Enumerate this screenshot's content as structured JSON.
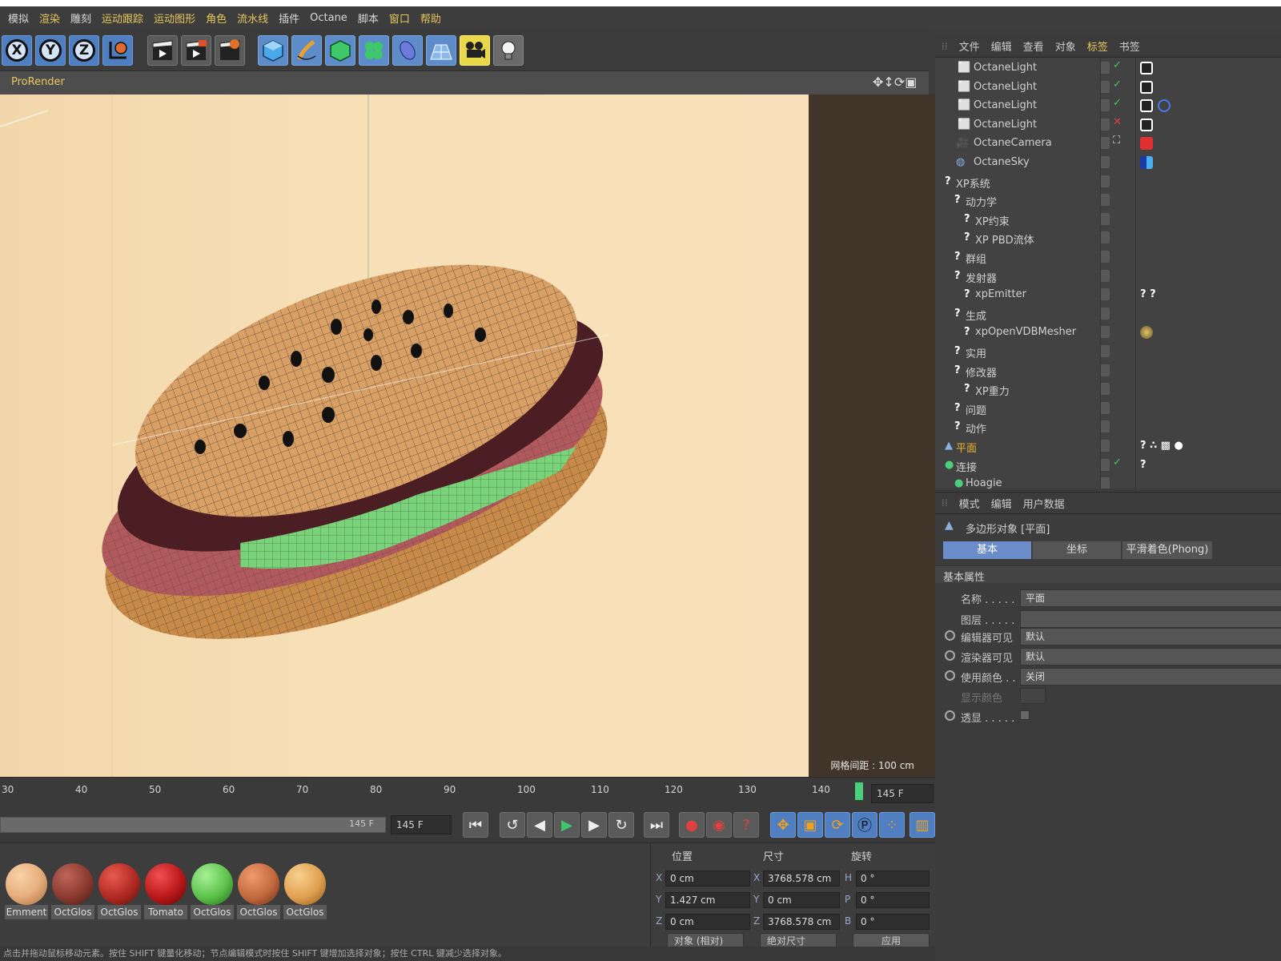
{
  "menu": {
    "items": [
      "模拟",
      "渲染",
      "雕刻",
      "运动跟踪",
      "运动图形",
      "角色",
      "流水线",
      "插件",
      "Octane",
      "脚本",
      "窗口",
      "帮助"
    ]
  },
  "toolbar": {
    "axis_x": "X",
    "axis_y": "Y",
    "axis_z": "Z",
    "icons": [
      "axis-x-icon",
      "axis-y-icon",
      "axis-z-icon",
      "world-coord-icon",
      "render-view-icon",
      "render-picture-queue-icon",
      "render-settings-icon",
      "cube-icon",
      "pen-icon",
      "subdivision-icon",
      "cloner-icon",
      "deformer-icon",
      "floor-icon",
      "camera-icon",
      "light-icon"
    ]
  },
  "viewport": {
    "renderer_label": "ProRender",
    "grid_label": "网格间距 : 100 cm"
  },
  "timeline": {
    "ticks": [
      "30",
      "40",
      "50",
      "60",
      "70",
      "80",
      "90",
      "100",
      "110",
      "120",
      "130",
      "140"
    ],
    "current_frame": "145 F"
  },
  "playbar": {
    "end_frame_slider": "145 F",
    "end_frame_field": "145 F"
  },
  "materials": [
    {
      "name": "Emment",
      "color": "#e8b07e"
    },
    {
      "name": "OctGlos",
      "color": "#8a3a2e"
    },
    {
      "name": "OctGlos",
      "color": "#b02a22"
    },
    {
      "name": "Tomato",
      "color": "#b81818"
    },
    {
      "name": "OctGlos",
      "color": "#5cc24a"
    },
    {
      "name": "OctGlos",
      "color": "#c26a3e"
    },
    {
      "name": "OctGlos",
      "color": "#e0a050"
    }
  ],
  "coords": {
    "headers": {
      "position": "位置",
      "size": "尺寸",
      "rotation": "旋转"
    },
    "rows": [
      {
        "axis": "X",
        "pos": "0 cm",
        "size_axis": "X",
        "size": "3768.578 cm",
        "rot_axis": "H",
        "rot": "0 °"
      },
      {
        "axis": "Y",
        "pos": "1.427 cm",
        "size_axis": "Y",
        "size": "0 cm",
        "rot_axis": "P",
        "rot": "0 °"
      },
      {
        "axis": "Z",
        "pos": "0 cm",
        "size_axis": "Z",
        "size": "3768.578 cm",
        "rot_axis": "B",
        "rot": "0 °"
      }
    ],
    "mode": "对象 (相对)",
    "size_mode": "绝对尺寸",
    "apply": "应用"
  },
  "status": {
    "text": "点击并拖动鼠标移动元素。按住 SHIFT 键量化移动；节点编辑模式时按住 SHIFT 键增加选择对象；按住 CTRL 键减少选择对象。"
  },
  "object_manager": {
    "menu": [
      "文件",
      "编辑",
      "查看",
      "对象",
      "标签",
      "书签"
    ],
    "objects": [
      {
        "name": "OctaneLight",
        "indent": 0,
        "icon": "light"
      },
      {
        "name": "OctaneLight",
        "indent": 0,
        "icon": "light"
      },
      {
        "name": "OctaneLight",
        "indent": 0,
        "icon": "light"
      },
      {
        "name": "OctaneLight",
        "indent": 0,
        "icon": "light"
      },
      {
        "name": "OctaneCamera",
        "indent": 0,
        "icon": "camera"
      },
      {
        "name": "OctaneSky",
        "indent": 0,
        "icon": "sky"
      },
      {
        "name": "XP系统",
        "indent": 0,
        "icon": "question"
      },
      {
        "name": "动力学",
        "indent": 1,
        "icon": "question"
      },
      {
        "name": "XP约束",
        "indent": 2,
        "icon": "question"
      },
      {
        "name": "XP PBD流体",
        "indent": 2,
        "icon": "question"
      },
      {
        "name": "群组",
        "indent": 1,
        "icon": "question"
      },
      {
        "name": "发射器",
        "indent": 1,
        "icon": "question"
      },
      {
        "name": "xpEmitter",
        "indent": 2,
        "icon": "question"
      },
      {
        "name": "生成",
        "indent": 1,
        "icon": "question"
      },
      {
        "name": "xpOpenVDBMesher",
        "indent": 2,
        "icon": "question"
      },
      {
        "name": "实用",
        "indent": 1,
        "icon": "question"
      },
      {
        "name": "修改器",
        "indent": 1,
        "icon": "question"
      },
      {
        "name": "XP重力",
        "indent": 2,
        "icon": "question"
      },
      {
        "name": "问题",
        "indent": 1,
        "icon": "question"
      },
      {
        "name": "动作",
        "indent": 1,
        "icon": "question"
      },
      {
        "name": "平面",
        "indent": 0,
        "icon": "plane"
      },
      {
        "name": "连接",
        "indent": 0,
        "icon": "connect"
      },
      {
        "name": "Hoagie",
        "indent": 0,
        "icon": "object"
      }
    ]
  },
  "attribute_manager": {
    "menu": [
      "模式",
      "编辑",
      "用户数据"
    ],
    "object_title": "多边形对象 [平面]",
    "tabs": [
      "基本",
      "坐标",
      "平滑着色(Phong)"
    ],
    "section": "基本属性",
    "fields": [
      {
        "label": "名称 . . . . .",
        "value": "平面"
      },
      {
        "label": "图层 . . . . .",
        "value": ""
      },
      {
        "label": "编辑器可见",
        "value": "默认"
      },
      {
        "label": "渲染器可见",
        "value": "默认"
      },
      {
        "label": "使用颜色 . .",
        "value": "关闭"
      },
      {
        "label": "显示颜色",
        "value": ""
      },
      {
        "label": "透显 . . . . .",
        "value": ""
      }
    ]
  }
}
